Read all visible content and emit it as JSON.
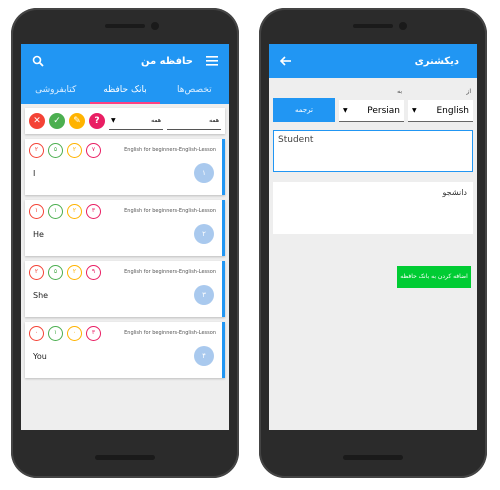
{
  "left": {
    "title": "حافظه من",
    "tabs": [
      "تخصص‌ها",
      "بانک حافظه",
      "کتابفروشی"
    ],
    "filters": {
      "select1": "همه",
      "select2": "همه",
      "buttons": [
        {
          "symbol": "✕",
          "color": "#f44336"
        },
        {
          "symbol": "✓",
          "color": "#4caf50"
        },
        {
          "symbol": "✎",
          "color": "#ffb300"
        },
        {
          "symbol": "?",
          "color": "#e91e63"
        }
      ]
    },
    "cards": [
      {
        "word": "I",
        "num": "۱",
        "crumb": "English for beginners-English-Lesson",
        "circles": [
          "۲",
          "۵",
          "۲",
          "۷"
        ]
      },
      {
        "word": "He",
        "num": "۲",
        "crumb": "English for beginners-English-Lesson",
        "circles": [
          "۱",
          "۱",
          "۲",
          "۳"
        ]
      },
      {
        "word": "She",
        "num": "۳",
        "crumb": "English for beginners-English-Lesson",
        "circles": [
          "۲",
          "۵",
          "۲",
          "۹"
        ]
      },
      {
        "word": "You",
        "num": "۴",
        "crumb": "English for beginners-English-Lesson",
        "circles": [
          "۰",
          "۱",
          "۰",
          "۳"
        ]
      }
    ],
    "circle_colors": [
      "#f44336",
      "#4caf50",
      "#ffb300",
      "#e91e63"
    ]
  },
  "right": {
    "title": "دیکشنری",
    "from_label": "از",
    "to_label": "به",
    "from_lang": "English",
    "to_lang": "Persian",
    "translate_label": "ترجمه",
    "input_text": "Student",
    "output_text": "دانشجو",
    "add_label": "اضافه کردن به بانک حافظه"
  }
}
